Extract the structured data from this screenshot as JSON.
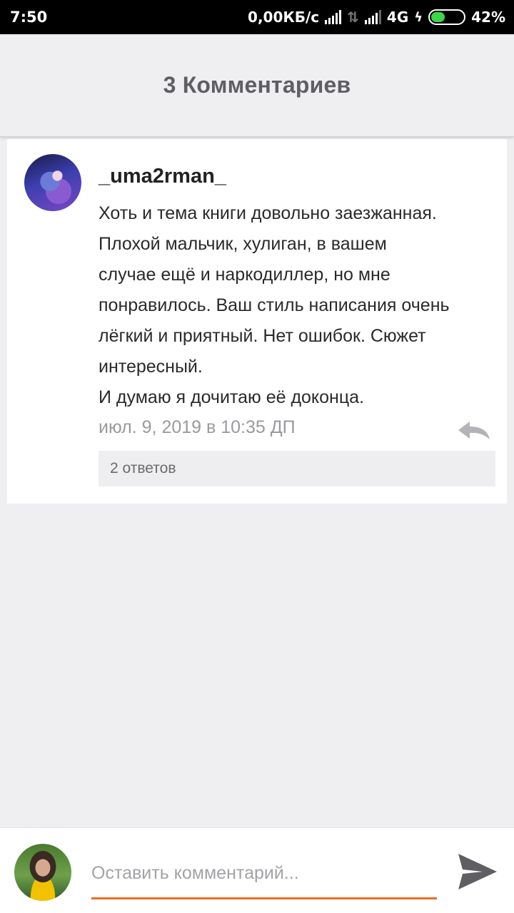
{
  "status_bar": {
    "time": "7:50",
    "network_speed": "0,00КБ/с",
    "network_type": "4G",
    "battery": "42%",
    "battery_level": 0.42,
    "battery_color": "#3bd64a"
  },
  "header": {
    "title": "3 Комментариев"
  },
  "comment": {
    "username": "_uma2rman_",
    "text": "Хоть и тема книги довольно заезжанная.\nПлохой мальчик, хулиган, в вашем\nслучае ещё и наркодиллер, но мне\nпонравилось. Ваш стиль написания очень\nлёгкий и приятный. Нет ошибок. Сюжет\nинтересный.\nИ думаю я дочитаю её доконца.",
    "timestamp": "июл. 9, 2019 в 10:35 ДП",
    "replies_label": "2 ответов",
    "reply_icon": "reply-arrow-icon"
  },
  "compose": {
    "placeholder": "Оставить комментарий...",
    "accent_color": "#ef6c25",
    "send_icon": "send-icon"
  }
}
